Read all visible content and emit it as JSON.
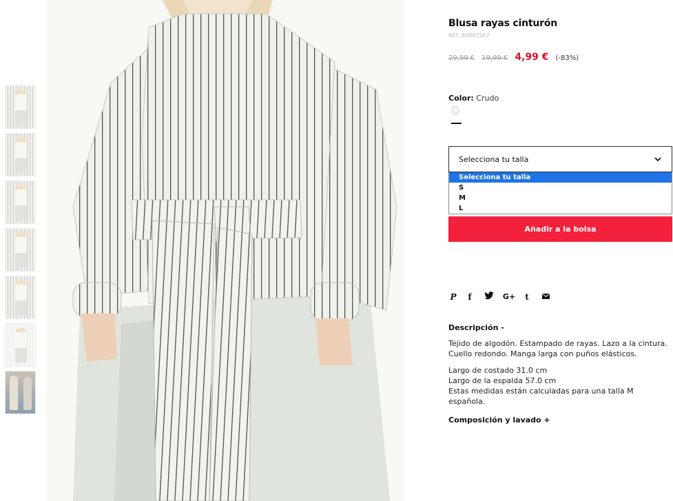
{
  "thumbnails": [
    {
      "alt": "thumbnail-1"
    },
    {
      "alt": "thumbnail-2"
    },
    {
      "alt": "thumbnail-3"
    },
    {
      "alt": "thumbnail-4"
    },
    {
      "alt": "thumbnail-5"
    },
    {
      "alt": "thumbnail-6"
    },
    {
      "alt": "thumbnail-7"
    }
  ],
  "product": {
    "title": "Blusa rayas cinturón",
    "ref": "REF. 83087567",
    "price_original": "29,99 €",
    "price_previous": "19,99 €",
    "price_current": "4,99 €",
    "discount": "(-83%)",
    "color_label": "Color:",
    "color_value": "Crudo"
  },
  "size_select": {
    "label": "Selecciona tu talla",
    "options": [
      "Selecciona tu talla",
      "S",
      "M",
      "L"
    ],
    "selected_index": 0
  },
  "add_to_bag": "Añadir a la bolsa",
  "share_icons": [
    "pinterest-icon",
    "facebook-icon",
    "twitter-icon",
    "google-plus-icon",
    "tumblr-icon",
    "email-icon"
  ],
  "description": {
    "heading": "Descripción -",
    "paragraph1": "Tejido de algodón. Estampado de rayas. Lazo a la cintura. Cuello redondo. Manga larga con puños elásticos.",
    "line1": "Largo de costado 31.0 cm",
    "line2": "Largo de la espalda 57.0 cm",
    "line3": "Estas medidas están calculadas para una talla M española."
  },
  "composition_heading": "Composición y lavado +",
  "colors": {
    "accent": "#f4213d",
    "sale_price": "#e0102b",
    "dropdown_highlight": "#1e74e6"
  }
}
